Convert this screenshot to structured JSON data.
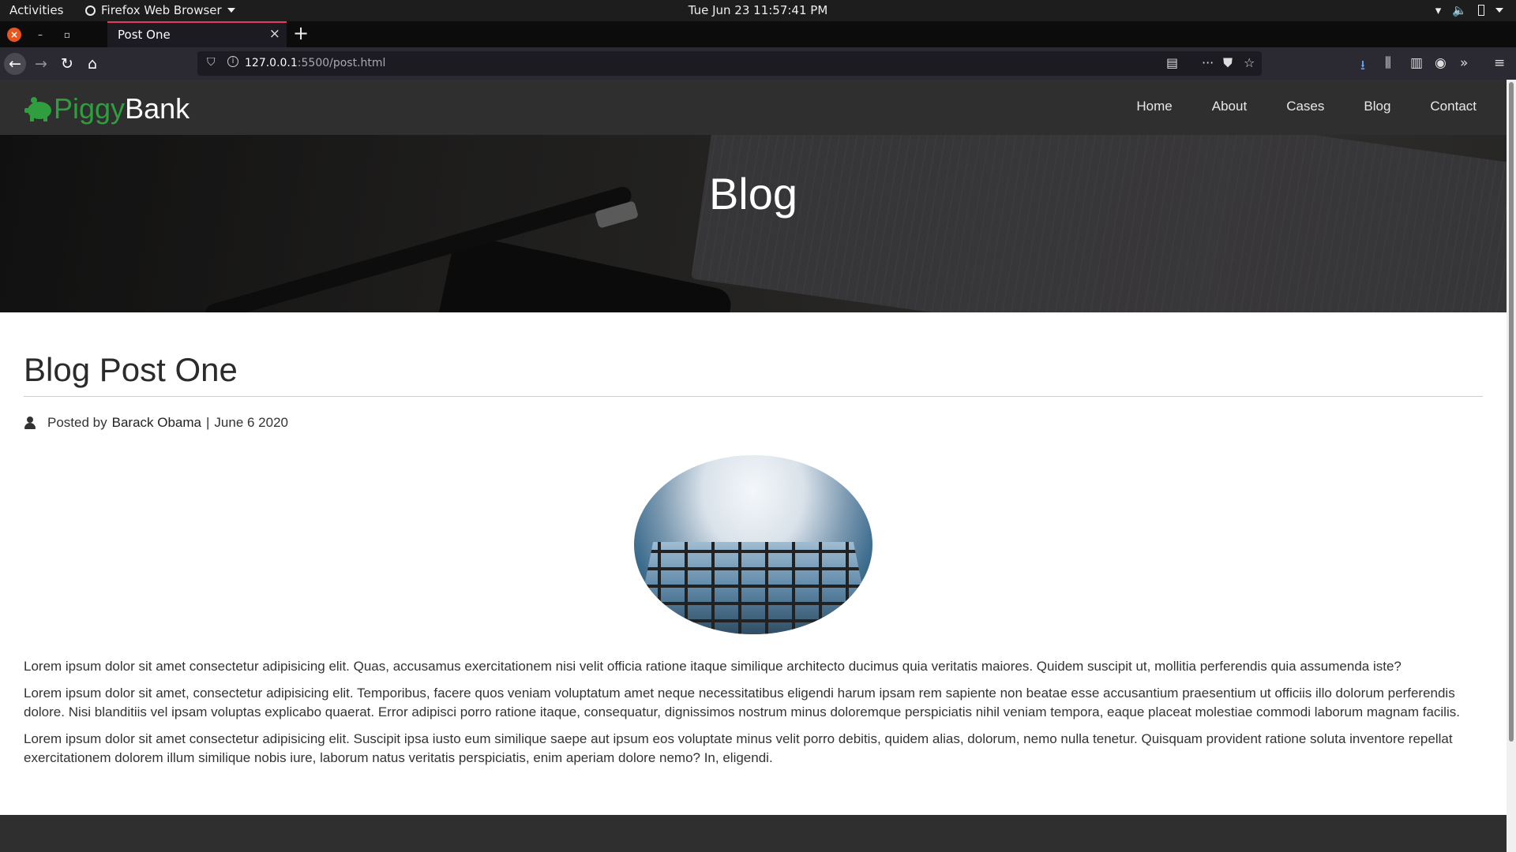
{
  "system_bar": {
    "activities": "Activities",
    "app_name": "Firefox Web Browser",
    "clock": "Tue Jun 23  11:57:41 PM"
  },
  "browser": {
    "tab_title": "Post One",
    "url_host": "127.0.0.1",
    "url_path": ":5500/post.html"
  },
  "site": {
    "logo_piggy": "Piggy",
    "logo_bank": "Bank",
    "nav": [
      "Home",
      "About",
      "Cases",
      "Blog",
      "Contact"
    ]
  },
  "hero": {
    "title": "Blog"
  },
  "post": {
    "title": "Blog Post One",
    "posted_by": "Posted by",
    "author": "Barack Obama",
    "separator": "|",
    "date": "June 6 2020",
    "paragraphs": [
      "Lorem ipsum dolor sit amet consectetur adipisicing elit. Quas, accusamus exercitationem nisi velit officia ratione itaque similique architecto ducimus quia veritatis maiores. Quidem suscipit ut, mollitia perferendis quia assumenda iste?",
      "Lorem ipsum dolor sit amet, consectetur adipisicing elit. Temporibus, facere quos veniam voluptatum amet neque necessitatibus eligendi harum ipsam rem sapiente non beatae esse accusantium praesentium ut officiis illo dolorum perferendis dolore. Nisi blanditiis vel ipsam voluptas explicabo quaerat. Error adipisci porro ratione itaque, consequatur, dignissimos nostrum minus doloremque perspiciatis nihil veniam tempora, eaque placeat molestiae commodi laborum magnam facilis.",
      "Lorem ipsum dolor sit amet consectetur adipisicing elit. Suscipit ipsa iusto eum similique saepe aut ipsum eos voluptate minus velit porro debitis, quidem alias, dolorum, nemo nulla tenetur. Quisquam provident ratione soluta inventore repellat exercitationem dolorem illum similique nobis iure, laborum natus veritatis perspiciatis, enim aperiam dolore nemo? In, eligendi."
    ]
  },
  "colors": {
    "brand_green": "#2e9e3e",
    "nav_bg": "#2f2f2f",
    "tab_accent": "#e43d5c"
  }
}
